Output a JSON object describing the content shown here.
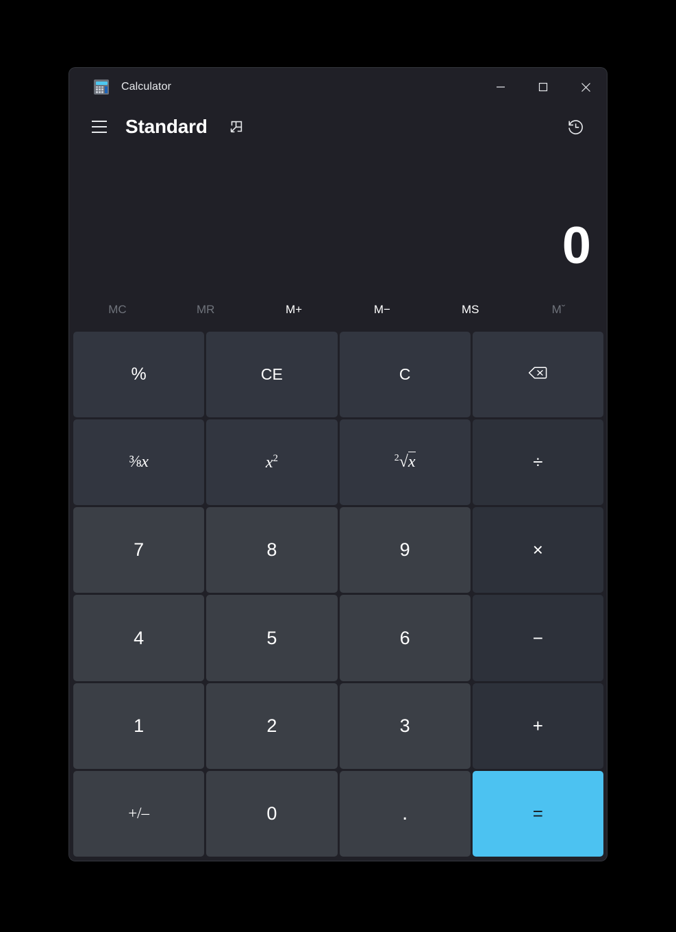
{
  "window": {
    "title": "Calculator",
    "app_icon": "calculator-icon",
    "controls": {
      "minimize": "minimize-icon",
      "maximize": "maximize-icon",
      "close": "close-icon"
    }
  },
  "header": {
    "menu_icon": "hamburger-menu-icon",
    "mode_title": "Standard",
    "keep_on_top_icon": "keep-on-top-icon",
    "history_icon": "history-clock-icon"
  },
  "display": {
    "expression": "",
    "value": "0"
  },
  "memory_buttons": [
    {
      "label": "MC",
      "name": "memory-clear-button",
      "disabled": true
    },
    {
      "label": "MR",
      "name": "memory-recall-button",
      "disabled": true
    },
    {
      "label": "M+",
      "name": "memory-add-button",
      "disabled": false
    },
    {
      "label": "M−",
      "name": "memory-subtract-button",
      "disabled": false
    },
    {
      "label": "MS",
      "name": "memory-store-button",
      "disabled": false
    },
    {
      "label": "Mˇ",
      "name": "memory-dropdown-button",
      "disabled": true
    }
  ],
  "keypad": {
    "percent": "%",
    "clear_entry": "CE",
    "clear": "C",
    "backspace": "backspace-icon",
    "reciprocal": "1/x",
    "square": "x2",
    "square_root": "2root-x",
    "divide": "÷",
    "seven": "7",
    "eight": "8",
    "nine": "9",
    "multiply": "×",
    "four": "4",
    "five": "5",
    "six": "6",
    "subtract": "−",
    "one": "1",
    "two": "2",
    "three": "3",
    "add": "+",
    "negate": "+/–",
    "zero": "0",
    "decimal": ".",
    "equals": "="
  },
  "colors": {
    "window_bg": "#202027",
    "number_key": "#3b3f46",
    "function_key": "#323640",
    "operator_key": "#2d313a",
    "accent": "#4cc2f1",
    "text": "#ffffff",
    "disabled_text": "#6f737b"
  }
}
